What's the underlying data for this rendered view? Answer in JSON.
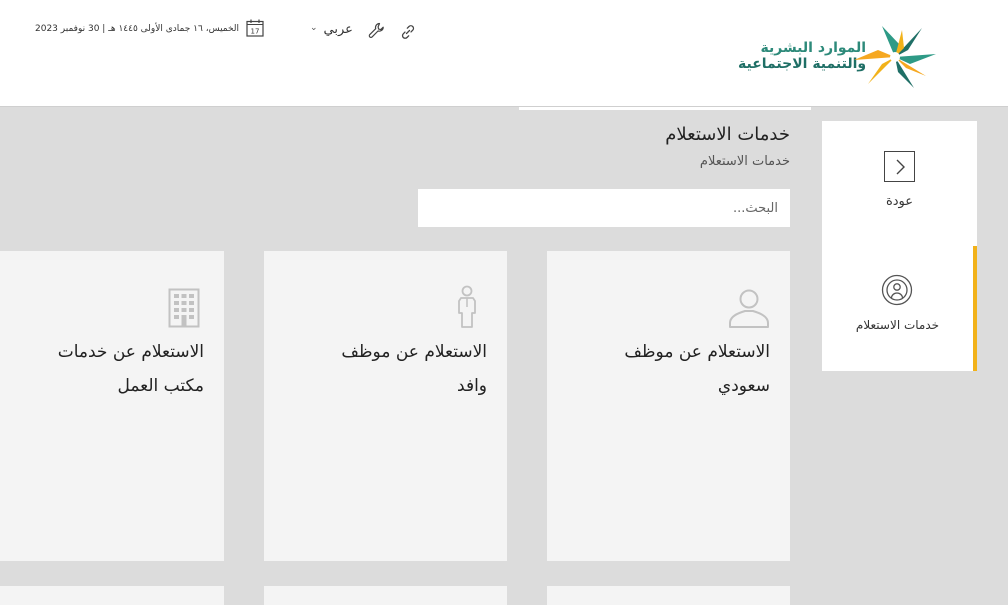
{
  "header": {
    "date": "الخميس، ١٦ جمادى الأولى ١٤٤٥ هـ | 30 نوفمبر 2023",
    "calendar_day": "17",
    "language": "عربي",
    "logo_line1": "الموارد البشرية",
    "logo_line2": "والتنمية الاجتماعية"
  },
  "main": {
    "title": "خدمات الاستعلام",
    "breadcrumb": "خدمات الاستعلام",
    "search_placeholder": "البحث..."
  },
  "sidebar": {
    "back_label": "عودة",
    "inquiry_label": "خدمات الاستعلام",
    "active_color": "#f2b21a"
  },
  "cards": [
    {
      "title_line1": "الاستعلام عن موظف",
      "title_line2": "سعودي",
      "icon": "person-icon"
    },
    {
      "title_line1": "الاستعلام عن موظف",
      "title_line2": "وافد",
      "icon": "standing-person-icon"
    },
    {
      "title_line1": "الاستعلام عن خدمات",
      "title_line2": "مكتب العمل",
      "icon": "building-icon"
    }
  ]
}
